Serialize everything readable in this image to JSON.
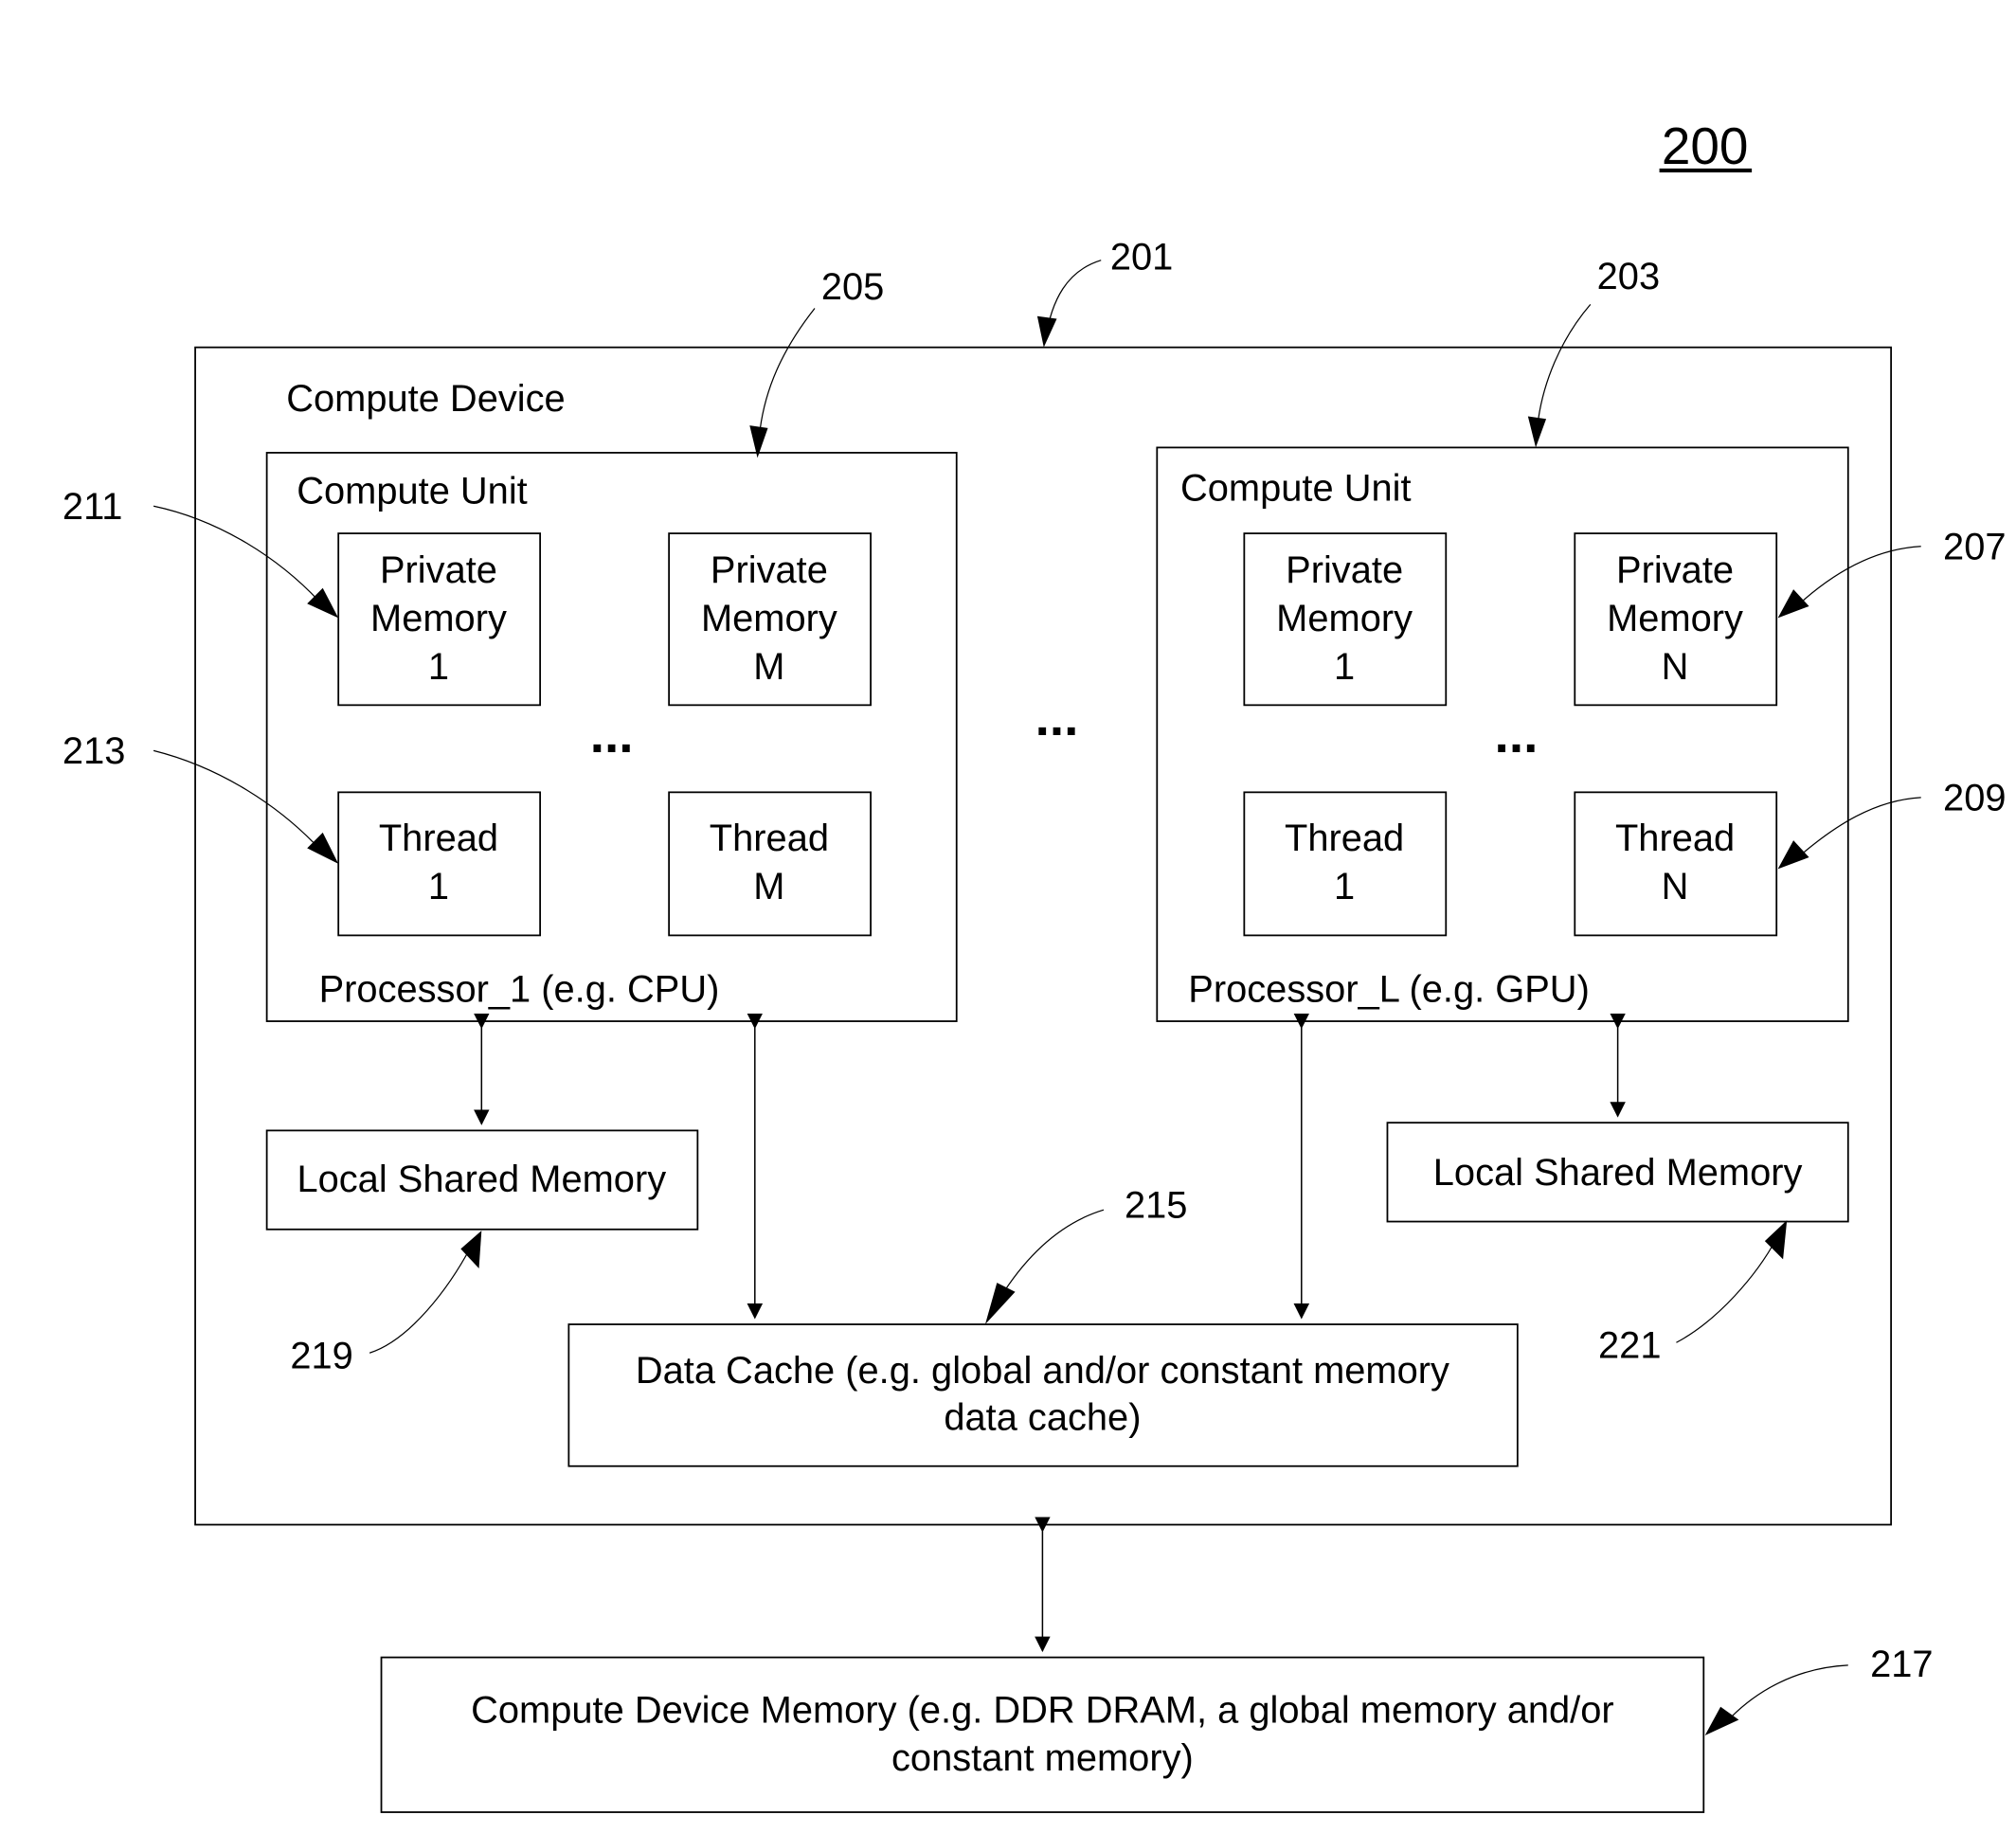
{
  "figure": {
    "number": "200",
    "compute_device": {
      "ref": "201",
      "title": "Compute Device",
      "ellipsis": "...",
      "processor_1": {
        "ref": "205",
        "unit_title": "Compute Unit",
        "caption": "Processor_1 (e.g. CPU)",
        "ellipsis": "...",
        "private_memory_1": {
          "ref": "211",
          "line1": "Private",
          "line2": "Memory",
          "line3": "1"
        },
        "private_memory_m": {
          "line1": "Private",
          "line2": "Memory",
          "line3": "M"
        },
        "thread_1": {
          "ref": "213",
          "line1": "Thread",
          "line2": "1"
        },
        "thread_m": {
          "line1": "Thread",
          "line2": "M"
        },
        "local_shared_memory": {
          "ref": "219",
          "label": "Local Shared Memory"
        }
      },
      "processor_l": {
        "ref": "203",
        "unit_title": "Compute Unit",
        "caption": "Processor_L (e.g. GPU)",
        "ellipsis": "...",
        "private_memory_1": {
          "line1": "Private",
          "line2": "Memory",
          "line3": "1"
        },
        "private_memory_n": {
          "ref": "207",
          "line1": "Private",
          "line2": "Memory",
          "line3": "N"
        },
        "thread_1": {
          "line1": "Thread",
          "line2": "1"
        },
        "thread_n": {
          "ref": "209",
          "line1": "Thread",
          "line2": "N"
        },
        "local_shared_memory": {
          "ref": "221",
          "label": "Local Shared Memory"
        }
      },
      "data_cache": {
        "ref": "215",
        "line1": "Data Cache (e.g. global and/or constant memory",
        "line2": "data cache)"
      }
    },
    "compute_device_memory": {
      "ref": "217",
      "line1": "Compute Device Memory (e.g. DDR DRAM, a global memory and/or",
      "line2": "constant memory)"
    }
  }
}
